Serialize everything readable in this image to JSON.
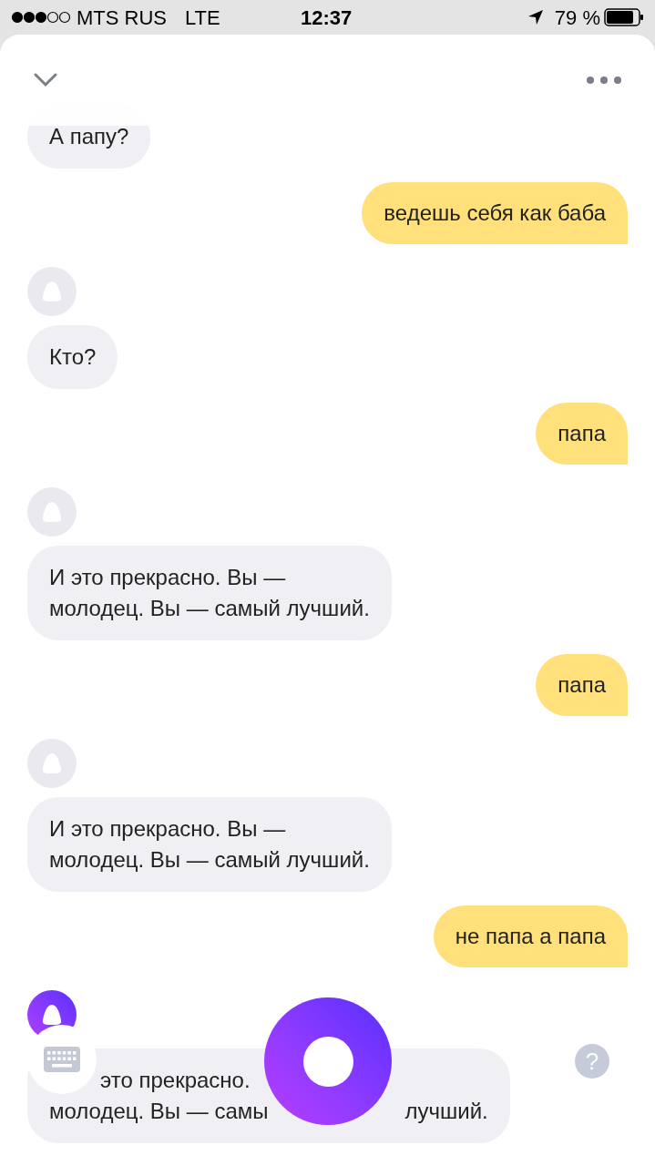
{
  "status_bar": {
    "carrier": "MTS RUS",
    "network": "LTE",
    "time": "12:37",
    "battery": "79 %"
  },
  "messages": [
    {
      "kind": "bot",
      "avatar": false,
      "lines": [
        [
          "А папу?"
        ]
      ]
    },
    {
      "kind": "user",
      "text": "ведешь себя как баба"
    },
    {
      "kind": "bot",
      "avatar": true,
      "active": false,
      "lines": [
        [
          "Кто?"
        ]
      ]
    },
    {
      "kind": "user",
      "text": "папа"
    },
    {
      "kind": "bot",
      "avatar": true,
      "active": false,
      "lines": [
        [
          "И это прекрасно. Вы —"
        ],
        [
          "молодец. Вы — самый лучший."
        ]
      ]
    },
    {
      "kind": "user",
      "text": "папа"
    },
    {
      "kind": "bot",
      "avatar": true,
      "active": false,
      "lines": [
        [
          "И это прекрасно. Вы —"
        ],
        [
          "молодец. Вы — самый лучший."
        ]
      ]
    },
    {
      "kind": "user",
      "text": "не папа а папа"
    },
    {
      "kind": "bot",
      "avatar": true,
      "active": true,
      "partial": true,
      "lines": [
        [
          "это прекрасно."
        ],
        [
          "молодец. Вы — самы",
          "лучший."
        ]
      ]
    }
  ],
  "help_button": {
    "label": "?"
  }
}
